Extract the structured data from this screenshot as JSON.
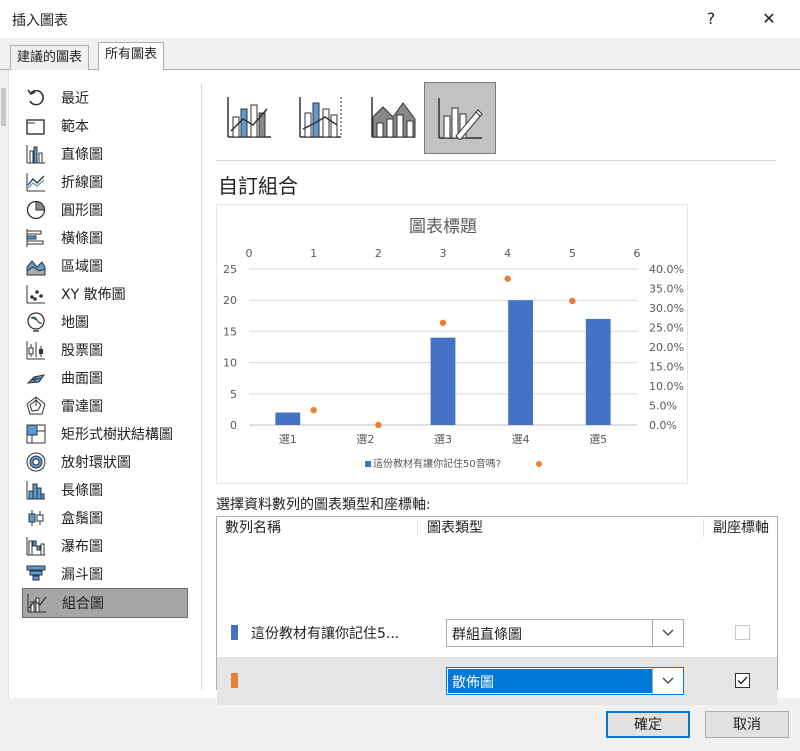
{
  "window": {
    "title": "插入圖表",
    "help": "?",
    "close": "✕"
  },
  "tabs": [
    {
      "label": "建議的圖表"
    },
    {
      "label": "所有圖表"
    }
  ],
  "sidebar": {
    "items": [
      {
        "label": "最近",
        "icon": "recent-icon"
      },
      {
        "label": "範本",
        "icon": "template-icon"
      },
      {
        "label": "直條圖",
        "icon": "column-chart-icon"
      },
      {
        "label": "折線圖",
        "icon": "line-chart-icon"
      },
      {
        "label": "圓形圖",
        "icon": "pie-chart-icon"
      },
      {
        "label": "橫條圖",
        "icon": "bar-chart-icon"
      },
      {
        "label": "區域圖",
        "icon": "area-chart-icon"
      },
      {
        "label": "XY 散佈圖",
        "icon": "scatter-chart-icon"
      },
      {
        "label": "地圖",
        "icon": "map-chart-icon"
      },
      {
        "label": "股票圖",
        "icon": "stock-chart-icon"
      },
      {
        "label": "曲面圖",
        "icon": "surface-chart-icon"
      },
      {
        "label": "雷達圖",
        "icon": "radar-chart-icon"
      },
      {
        "label": "矩形式樹狀結構圖",
        "icon": "treemap-chart-icon"
      },
      {
        "label": "放射環狀圖",
        "icon": "sunburst-chart-icon"
      },
      {
        "label": "長條圖",
        "icon": "histogram-chart-icon"
      },
      {
        "label": "盒鬚圖",
        "icon": "box-whisker-chart-icon"
      },
      {
        "label": "瀑布圖",
        "icon": "waterfall-chart-icon"
      },
      {
        "label": "漏斗圖",
        "icon": "funnel-chart-icon"
      },
      {
        "label": "組合圖",
        "icon": "combo-chart-icon",
        "selected": true
      }
    ]
  },
  "section_title": "自訂組合",
  "series_section": {
    "label": "選擇資料數列的圖表類型和座標軸:",
    "headers": {
      "name": "數列名稱",
      "type": "圖表類型",
      "secondary": "副座標軸"
    },
    "rows": [
      {
        "name": "這份教材有讓你記住5...",
        "color": "#4472c4",
        "type": "群組直條圖",
        "secondary": false
      },
      {
        "name": "",
        "color": "#ed7d31",
        "type": "散佈圖",
        "secondary": true
      }
    ]
  },
  "buttons": {
    "ok": "確定",
    "cancel": "取消"
  },
  "chart_data": {
    "type": "bar",
    "title": "圖表標題",
    "categories": [
      "選1",
      "選2",
      "選3",
      "選4",
      "選5"
    ],
    "y_ticks": [
      "0",
      "5",
      "10",
      "15",
      "20",
      "25"
    ],
    "y2_ticks": [
      "0.0%",
      "5.0%",
      "10.0%",
      "15.0%",
      "20.0%",
      "25.0%",
      "30.0%",
      "35.0%",
      "40.0%"
    ],
    "x2_ticks": [
      "0",
      "1",
      "2",
      "3",
      "4",
      "5",
      "6"
    ],
    "ylim": [
      0,
      25
    ],
    "y2lim": [
      0,
      0.4
    ],
    "x2lim": [
      0,
      6
    ],
    "series": [
      {
        "name": "這份教材有讓你記住50音嗎?",
        "type": "bar",
        "color": "#4472c4",
        "values": [
          2,
          0,
          14,
          20,
          17
        ]
      },
      {
        "name": "",
        "type": "scatter",
        "color": "#ed7d31",
        "axis": "secondary",
        "points": [
          {
            "x": 1,
            "y": 0.038
          },
          {
            "x": 2,
            "y": 0.0
          },
          {
            "x": 3,
            "y": 0.262
          },
          {
            "x": 4,
            "y": 0.375
          },
          {
            "x": 5,
            "y": 0.318
          }
        ]
      }
    ],
    "legend": "bottom",
    "grid": true
  }
}
